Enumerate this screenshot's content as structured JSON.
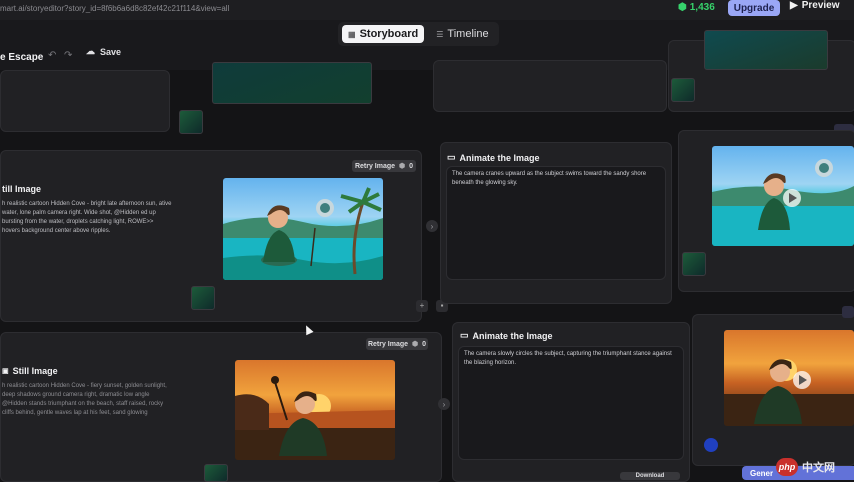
{
  "browser": {
    "url": "mart.ai/storyeditor?story_id=8f6b6a6d8c82ef42c21f114&view=all"
  },
  "header": {
    "credits": "1,436",
    "upgrade_label": "Upgrade",
    "preview_label": "Preview",
    "project_name": "e Escape",
    "save_label": "Save",
    "tabs": [
      {
        "label": "Storyboard",
        "active": true
      },
      {
        "label": "Timeline",
        "active": false
      }
    ]
  },
  "scenes": [
    {
      "still_title": "till Image",
      "prompt": "h realistic cartoon Hidden Cove - bright late afternoon sun, ative water, lone palm camera right. Wide shot, @Hidden ed up bursting from the water, droplets catching light, ROWE>> hovers background center above ripples.",
      "retry_label": "Retry Image",
      "retry_count": "0",
      "animate_title": "Animate the Image",
      "animation_desc": "The camera cranes upward as the subject swims toward the sandy shore beneath the glowing sky."
    },
    {
      "still_title": "Still Image",
      "prompt": "h realistic cartoon Hidden Cove - fiery sunset, golden sunlight, deep shadows ground camera right, dramatic low angle @Hidden stands triumphant on the beach, staff raised, rocky cliffs behind, gentle waves lap at his feet, sand glowing",
      "retry_label": "Retry Image",
      "retry_count": "0",
      "animate_title": "Animate the Image",
      "animation_desc": "The camera slowly circles the subject, capturing the triumphant stance against the blazing horizon.",
      "download_label": "Download"
    }
  ],
  "side_button_label": "Gener",
  "watermark": {
    "logo": "php",
    "text": "中文网"
  },
  "colors": {
    "accent": "#6272d8",
    "credits_green": "#36d26b",
    "upgrade": "#9aa7f6"
  }
}
